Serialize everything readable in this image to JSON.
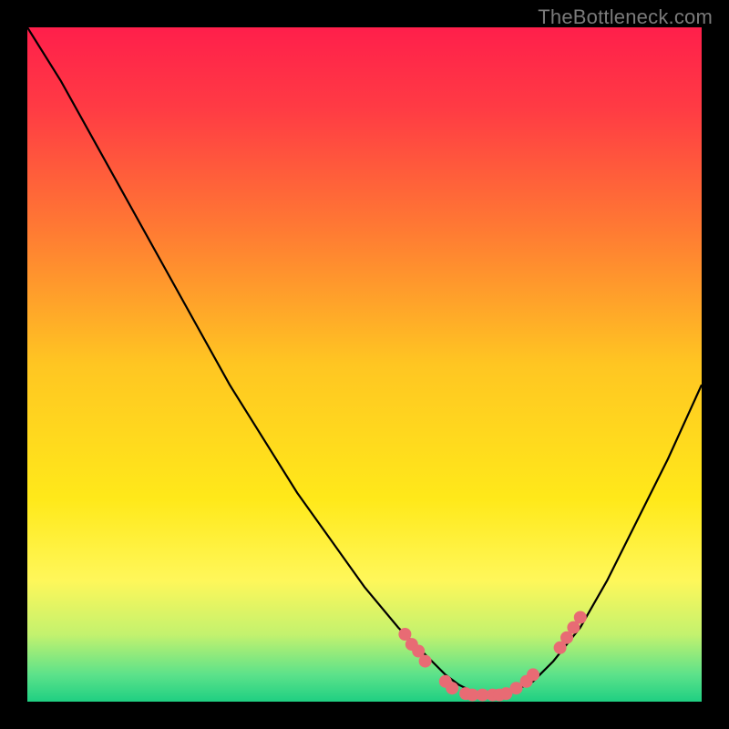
{
  "watermark": "TheBottleneck.com",
  "chart_data": {
    "type": "line",
    "title": "",
    "xlabel": "",
    "ylabel": "",
    "xlim": [
      0,
      100
    ],
    "ylim": [
      0,
      100
    ],
    "background_gradient": {
      "type": "vertical",
      "stops": [
        {
          "offset": 0.0,
          "color": "#ff1f4b"
        },
        {
          "offset": 0.12,
          "color": "#ff3b44"
        },
        {
          "offset": 0.3,
          "color": "#ff7a33"
        },
        {
          "offset": 0.5,
          "color": "#ffc622"
        },
        {
          "offset": 0.7,
          "color": "#ffe91a"
        },
        {
          "offset": 0.82,
          "color": "#fff75a"
        },
        {
          "offset": 0.9,
          "color": "#c4f26e"
        },
        {
          "offset": 0.96,
          "color": "#5ce28a"
        },
        {
          "offset": 1.0,
          "color": "#1fcf82"
        }
      ]
    },
    "series": [
      {
        "name": "bottleneck-curve",
        "color": "#000000",
        "x": [
          0,
          5,
          10,
          15,
          20,
          25,
          30,
          35,
          40,
          45,
          50,
          55,
          58,
          60,
          62,
          64,
          66,
          68,
          70,
          72,
          75,
          78,
          82,
          86,
          90,
          95,
          100
        ],
        "y": [
          100,
          92,
          83,
          74,
          65,
          56,
          47,
          39,
          31,
          24,
          17,
          11,
          8,
          6,
          4,
          2.5,
          1.5,
          1,
          1,
          1.5,
          3,
          6,
          11,
          18,
          26,
          36,
          47
        ]
      }
    ],
    "markers": {
      "name": "curve-data-points",
      "color": "#e86b74",
      "radius": 7,
      "points": [
        {
          "x": 56,
          "y": 10
        },
        {
          "x": 57,
          "y": 8.5
        },
        {
          "x": 58,
          "y": 7.5
        },
        {
          "x": 59,
          "y": 6
        },
        {
          "x": 62,
          "y": 3
        },
        {
          "x": 63,
          "y": 2
        },
        {
          "x": 65,
          "y": 1.2
        },
        {
          "x": 66,
          "y": 1
        },
        {
          "x": 67.5,
          "y": 1
        },
        {
          "x": 69,
          "y": 1
        },
        {
          "x": 70,
          "y": 1
        },
        {
          "x": 71,
          "y": 1.2
        },
        {
          "x": 72.5,
          "y": 2
        },
        {
          "x": 74,
          "y": 3
        },
        {
          "x": 75,
          "y": 4
        },
        {
          "x": 79,
          "y": 8
        },
        {
          "x": 80,
          "y": 9.5
        },
        {
          "x": 81,
          "y": 11
        },
        {
          "x": 82,
          "y": 12.5
        }
      ]
    }
  }
}
